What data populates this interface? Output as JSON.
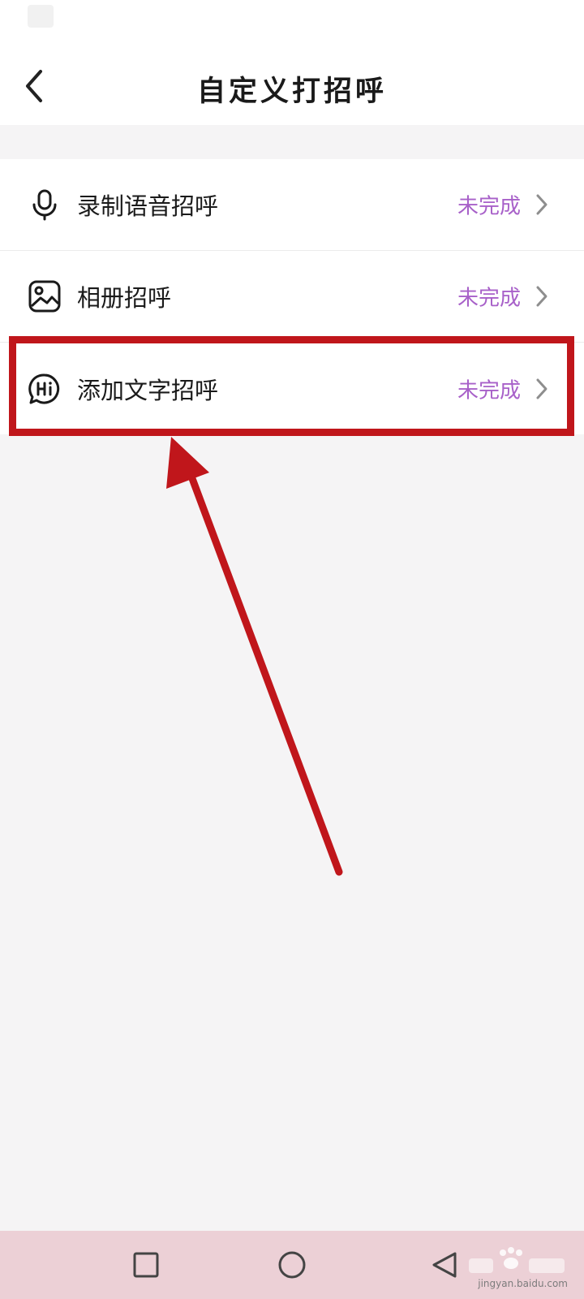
{
  "header": {
    "title": "自定义打招呼",
    "back_icon": "chevron-left-icon"
  },
  "settings": {
    "items": [
      {
        "label": "录制语音招呼",
        "status": "未完成",
        "icon": "microphone-icon"
      },
      {
        "label": "相册招呼",
        "status": "未完成",
        "icon": "photo-album-icon"
      },
      {
        "label": "添加文字招呼",
        "status": "未完成",
        "icon": "hi-chat-bubble-icon"
      }
    ]
  },
  "colors": {
    "status_accent": "#a861c9",
    "annotation_red": "#c0161b",
    "nav_bar_bg": "#ecd0d6",
    "page_bg": "#f5f4f5"
  },
  "nav_bar": {
    "buttons": [
      "recent-apps-icon",
      "home-icon",
      "back-triangle-icon"
    ]
  },
  "watermark": {
    "text": "jingyan.baidu.com"
  }
}
